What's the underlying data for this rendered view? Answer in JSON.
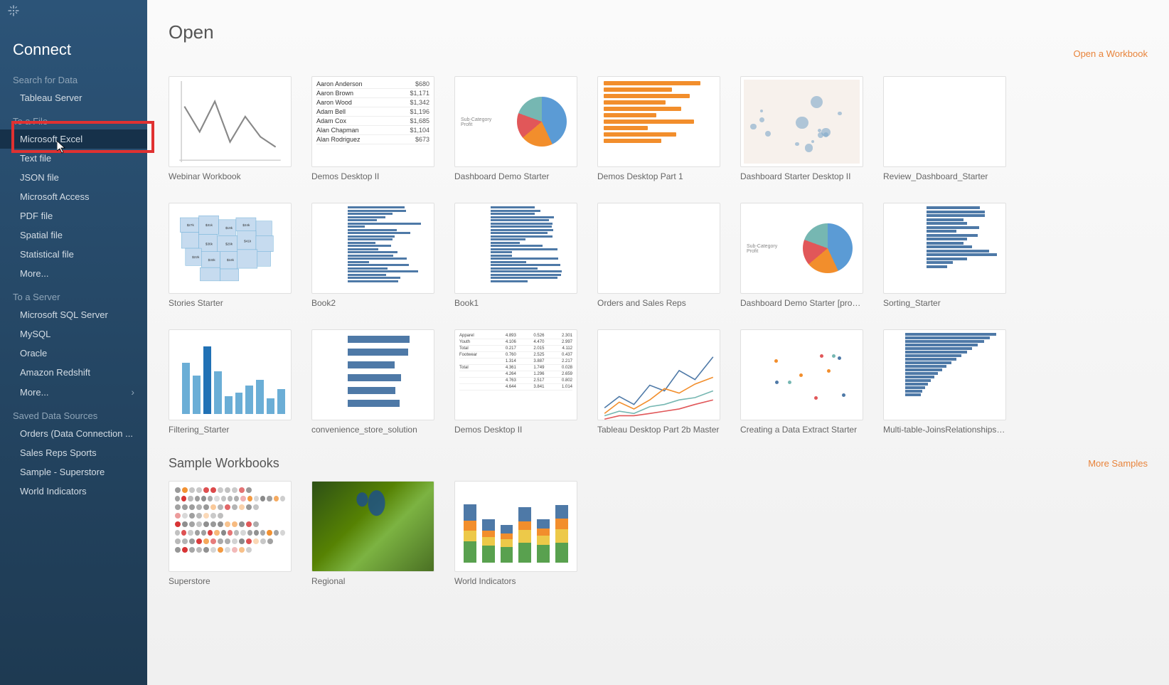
{
  "sidebar": {
    "connect": "Connect",
    "search_header": "Search for Data",
    "search_items": [
      "Tableau Server"
    ],
    "file_header": "To a File",
    "file_items": [
      "Microsoft Excel",
      "Text file",
      "JSON file",
      "Microsoft Access",
      "PDF file",
      "Spatial file",
      "Statistical file",
      "More..."
    ],
    "server_header": "To a Server",
    "server_items": [
      "Microsoft SQL Server",
      "MySQL",
      "Oracle",
      "Amazon Redshift",
      "More..."
    ],
    "saved_header": "Saved Data Sources",
    "saved_items": [
      "Orders (Data Connection ...",
      "Sales Reps Sports",
      "Sample - Superstore",
      "World Indicators"
    ]
  },
  "main": {
    "open_title": "Open",
    "open_workbook_link": "Open a Workbook",
    "sample_title": "Sample Workbooks",
    "more_samples_link": "More Samples",
    "workbooks_row1": [
      {
        "label": "Webinar Workbook",
        "type": "line"
      },
      {
        "label": "Demos Desktop II",
        "type": "table"
      },
      {
        "label": "Dashboard Demo Starter",
        "type": "pie"
      },
      {
        "label": "Demos Desktop Part 1",
        "type": "hbars-orange"
      },
      {
        "label": "Dashboard Starter Desktop II",
        "type": "scatter"
      },
      {
        "label": "Review_Dashboard_Starter",
        "type": "blank"
      }
    ],
    "workbooks_row2": [
      {
        "label": "Stories Starter",
        "type": "usmap"
      },
      {
        "label": "Book2",
        "type": "hbars-dense-left"
      },
      {
        "label": "Book1",
        "type": "hbars-dense"
      },
      {
        "label": "Orders and Sales Reps",
        "type": "blank"
      },
      {
        "label": "Dashboard Demo Starter [prod-u...",
        "type": "pie"
      },
      {
        "label": "Sorting_Starter",
        "type": "hbars-grouped"
      }
    ],
    "workbooks_row3": [
      {
        "label": "Filtering_Starter",
        "type": "bars"
      },
      {
        "label": "convenience_store_solution",
        "type": "hbars-sparse"
      },
      {
        "label": "Demos Desktop II",
        "type": "table-num"
      },
      {
        "label": "Tableau Desktop Part 2b Master",
        "type": "multiline"
      },
      {
        "label": "Creating a Data Extract Starter",
        "type": "scatter-mc"
      },
      {
        "label": "Multi-table-JoinsRelationships St...",
        "type": "hbars-right"
      }
    ],
    "samples": [
      {
        "label": "Superstore",
        "type": "dotplot"
      },
      {
        "label": "Regional",
        "type": "greenmap"
      },
      {
        "label": "World Indicators",
        "type": "stacked"
      }
    ]
  },
  "thumb_table": {
    "rows": [
      {
        "name": "Aaron Anderson",
        "val": "$680"
      },
      {
        "name": "Aaron Brown",
        "val": "$1,171"
      },
      {
        "name": "Aaron Wood",
        "val": "$1,342"
      },
      {
        "name": "Adam Bell",
        "val": "$1,196"
      },
      {
        "name": "Adam Cox",
        "val": "$1,685"
      },
      {
        "name": "Alan Chapman",
        "val": "$1,104"
      },
      {
        "name": "Alan Rodriguez",
        "val": "$673"
      }
    ]
  },
  "colors": {
    "accent": "#e8833a",
    "sidebar_bg": "#2c5478",
    "highlight_red": "#e03131"
  }
}
